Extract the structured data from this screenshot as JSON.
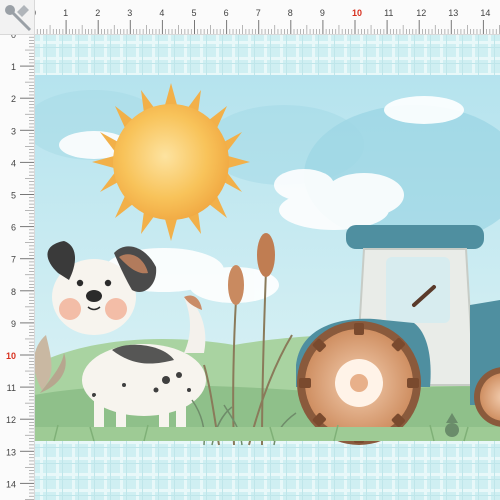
{
  "ruler": {
    "unit_labels": [
      "0",
      "1",
      "2",
      "3",
      "4",
      "5",
      "6",
      "7",
      "8",
      "9",
      "10",
      "11",
      "12",
      "13",
      "14"
    ],
    "accent_label": "10",
    "accent_color": "#d7301f"
  },
  "artwork": {
    "elements": [
      "sun",
      "clouds",
      "dog",
      "cattails",
      "tractor",
      "grass"
    ],
    "palette": {
      "sky": "#a9dbe8",
      "border_plaid": "#d4f1f3",
      "sun": "#f7c65a",
      "tractor_body": "#4f8fa0",
      "wheel": "#d79c72",
      "grass": "#8fc08a"
    }
  },
  "icons": {
    "pin": "pushpin-icon"
  }
}
